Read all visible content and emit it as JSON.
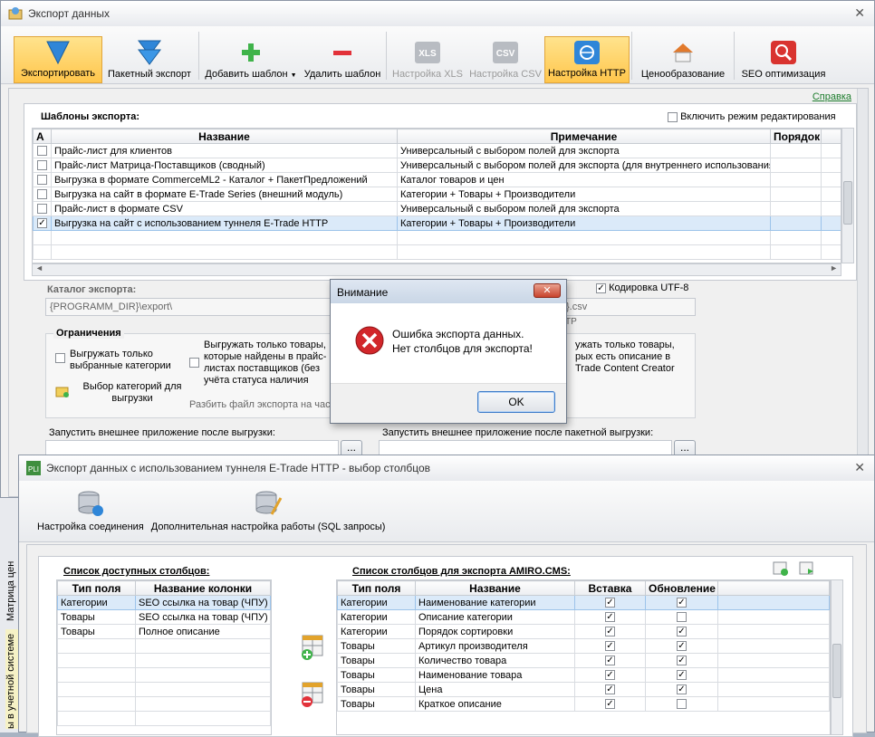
{
  "main_window": {
    "title": "Экспорт данных",
    "toolbar": [
      {
        "label": "Экспортировать",
        "icon": "export-arrow-icon",
        "state": "active"
      },
      {
        "label": "Пакетный экспорт",
        "icon": "batch-export-icon",
        "state": "normal"
      },
      {
        "label": "Добавить шаблон",
        "icon": "plus-icon",
        "state": "normal"
      },
      {
        "label": "Удалить шаблон",
        "icon": "minus-icon",
        "state": "normal"
      },
      {
        "label": "Настройка XLS",
        "icon": "xls-icon",
        "state": "disabled"
      },
      {
        "label": "Настройка CSV",
        "icon": "csv-icon",
        "state": "disabled"
      },
      {
        "label": "Настройка HTTP",
        "icon": "http-globe-icon",
        "state": "active"
      },
      {
        "label": "Ценообразование",
        "icon": "price-house-icon",
        "state": "normal"
      },
      {
        "label": "SEO оптимизация",
        "icon": "seo-magnifier-icon",
        "state": "normal"
      }
    ],
    "help_link": "Справка",
    "templates_label": "Шаблоны экспорта:",
    "edit_mode_label": "Включить режим редактирования",
    "templates_columns": [
      "A",
      "Название",
      "Примечание",
      "Порядок"
    ],
    "templates": [
      {
        "checked": false,
        "name": "Прайс-лист для клиентов",
        "note": "Универсальный с выбором полей для экспорта"
      },
      {
        "checked": false,
        "name": "Прайс-лист Матрица-Поставщиков (сводный)",
        "note": "Универсальный с выбором полей для экспорта (для внутреннего использования"
      },
      {
        "checked": false,
        "name": "Выгрузка в формате CommerceML2 - Каталог + ПакетПредложений",
        "note": "Каталог товаров и цен"
      },
      {
        "checked": false,
        "name": "Выгрузка на сайт в формате E-Trade Series (внешний модуль)",
        "note": "Категории + Товары + Производители"
      },
      {
        "checked": false,
        "name": "Прайс-лист в формате CSV",
        "note": "Универсальный с выбором полей для экспорта"
      },
      {
        "checked": true,
        "name": "Выгрузка на сайт с использованием туннеля E-Trade HTTP",
        "note": "Категории + Товары + Производители"
      }
    ],
    "catalog_label": "Каталог экспорта:",
    "catalog_value": "{PROGRAMM_DIR}\\export\\",
    "file_value_tail": "}.csv",
    "utf8_label": "Кодировка UTF-8",
    "tp_fragment": "TP",
    "limits_title": "Ограничения",
    "only_selected_categories": "Выгружать только выбранные категории",
    "select_categories": "Выбор категорий для выгрузки",
    "only_found_goods": "Выгружать только товары, которые найдены в прайс-листах поставщиков (без учёта статуса наличия",
    "split_file": "Разбить файл экспорта на част",
    "only_described_goods_1": "ужать только товары,",
    "only_described_goods_2": "рых есть описание в",
    "only_described_goods_3": "Trade Content Creator",
    "run_after_label": "Запустить внешнее приложение после выгрузки:",
    "run_after_batch_label": "Запустить внешнее приложение после пакетной выгрузки:",
    "browse": "..."
  },
  "dialog": {
    "title": "Внимание",
    "line1": "Ошибка экспорта данных.",
    "line2": "Нет столбцов для экспорта!",
    "ok": "OK"
  },
  "columns_window": {
    "title": "Экспорт данных с использованием туннеля E-Trade HTTP - выбор столбцов",
    "toolbar": [
      {
        "label": "Настройка соединения",
        "icon": "database-connection-icon"
      },
      {
        "label": "Дополнительная настройка работы (SQL запросы)",
        "icon": "database-sql-icon"
      }
    ],
    "available_title": "Список доступных столбцов:",
    "available_columns": [
      "Тип поля",
      "Название колонки"
    ],
    "available_rows": [
      {
        "type": "Категории",
        "name": "SEO ссылка на товар (ЧПУ)"
      },
      {
        "type": "Товары",
        "name": "SEO ссылка на товар (ЧПУ)"
      },
      {
        "type": "Товары",
        "name": "Полное описание"
      }
    ],
    "export_title": "Список столбцов для экспорта AMIRO.CMS:",
    "export_columns": [
      "Тип поля",
      "Название",
      "Вставка",
      "Обновление"
    ],
    "export_rows": [
      {
        "type": "Категории",
        "name": "Наименование категории",
        "insert": true,
        "update": true
      },
      {
        "type": "Категории",
        "name": "Описание категории",
        "insert": true,
        "update": false
      },
      {
        "type": "Категории",
        "name": "Порядок сортировки",
        "insert": true,
        "update": true
      },
      {
        "type": "Товары",
        "name": "Артикул производителя",
        "insert": true,
        "update": true
      },
      {
        "type": "Товары",
        "name": "Количество товара",
        "insert": true,
        "update": true
      },
      {
        "type": "Товары",
        "name": "Наименование товара",
        "insert": true,
        "update": true
      },
      {
        "type": "Товары",
        "name": "Цена",
        "insert": true,
        "update": true
      },
      {
        "type": "Товары",
        "name": "Краткое описание",
        "insert": true,
        "update": false
      }
    ]
  },
  "background_tab": {
    "text1": "Матрица цен поставщиков",
    "text2": "ы в учетной системе"
  }
}
